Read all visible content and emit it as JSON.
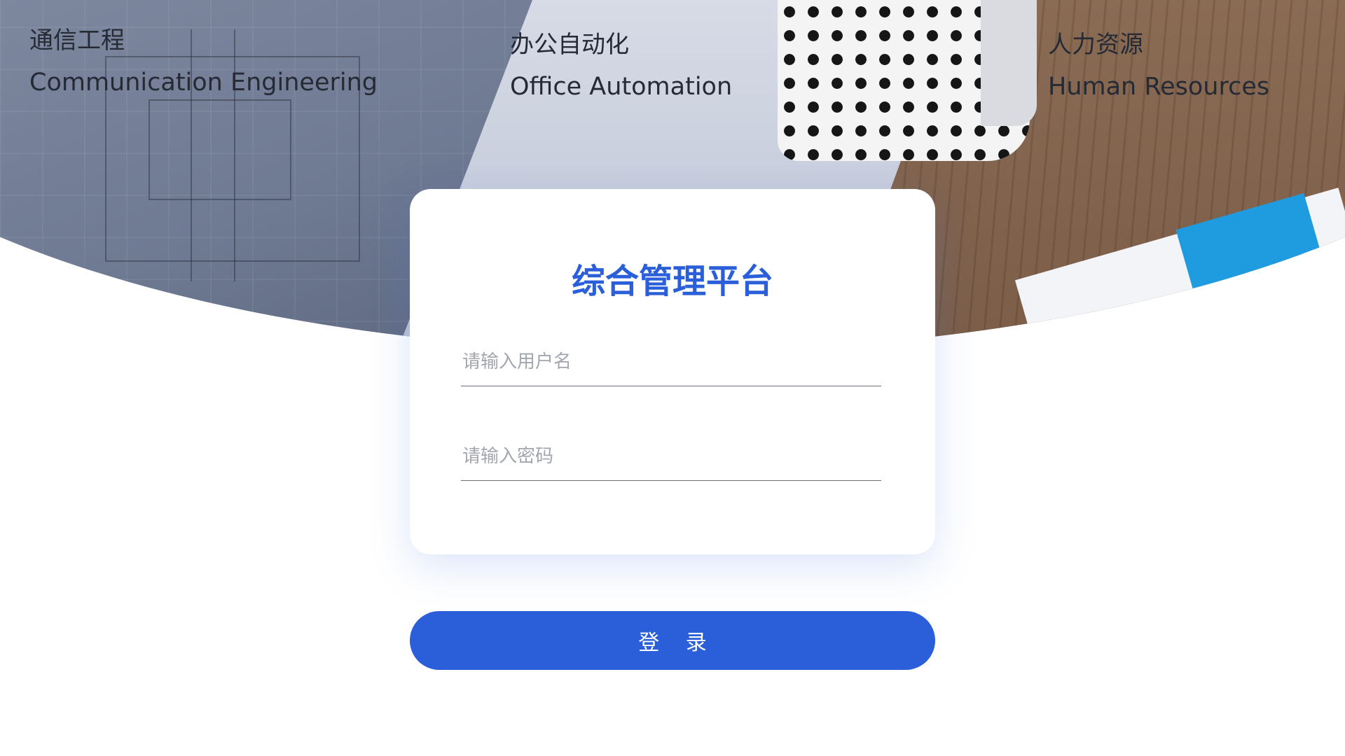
{
  "categories": [
    {
      "cn": "通信工程",
      "en": "Communication Engineering"
    },
    {
      "cn": "办公自动化",
      "en": "Office Automation"
    },
    {
      "cn": "人力资源",
      "en": "Human Resources"
    }
  ],
  "login": {
    "title": "综合管理平台",
    "username_placeholder": "请输入用户名",
    "password_placeholder": "请输入密码",
    "submit_label": "登 录"
  },
  "colors": {
    "accent": "#2B5FD9",
    "card_bg": "#FFFFFF",
    "text_dark": "#252A35",
    "placeholder": "#A2A6AE"
  }
}
